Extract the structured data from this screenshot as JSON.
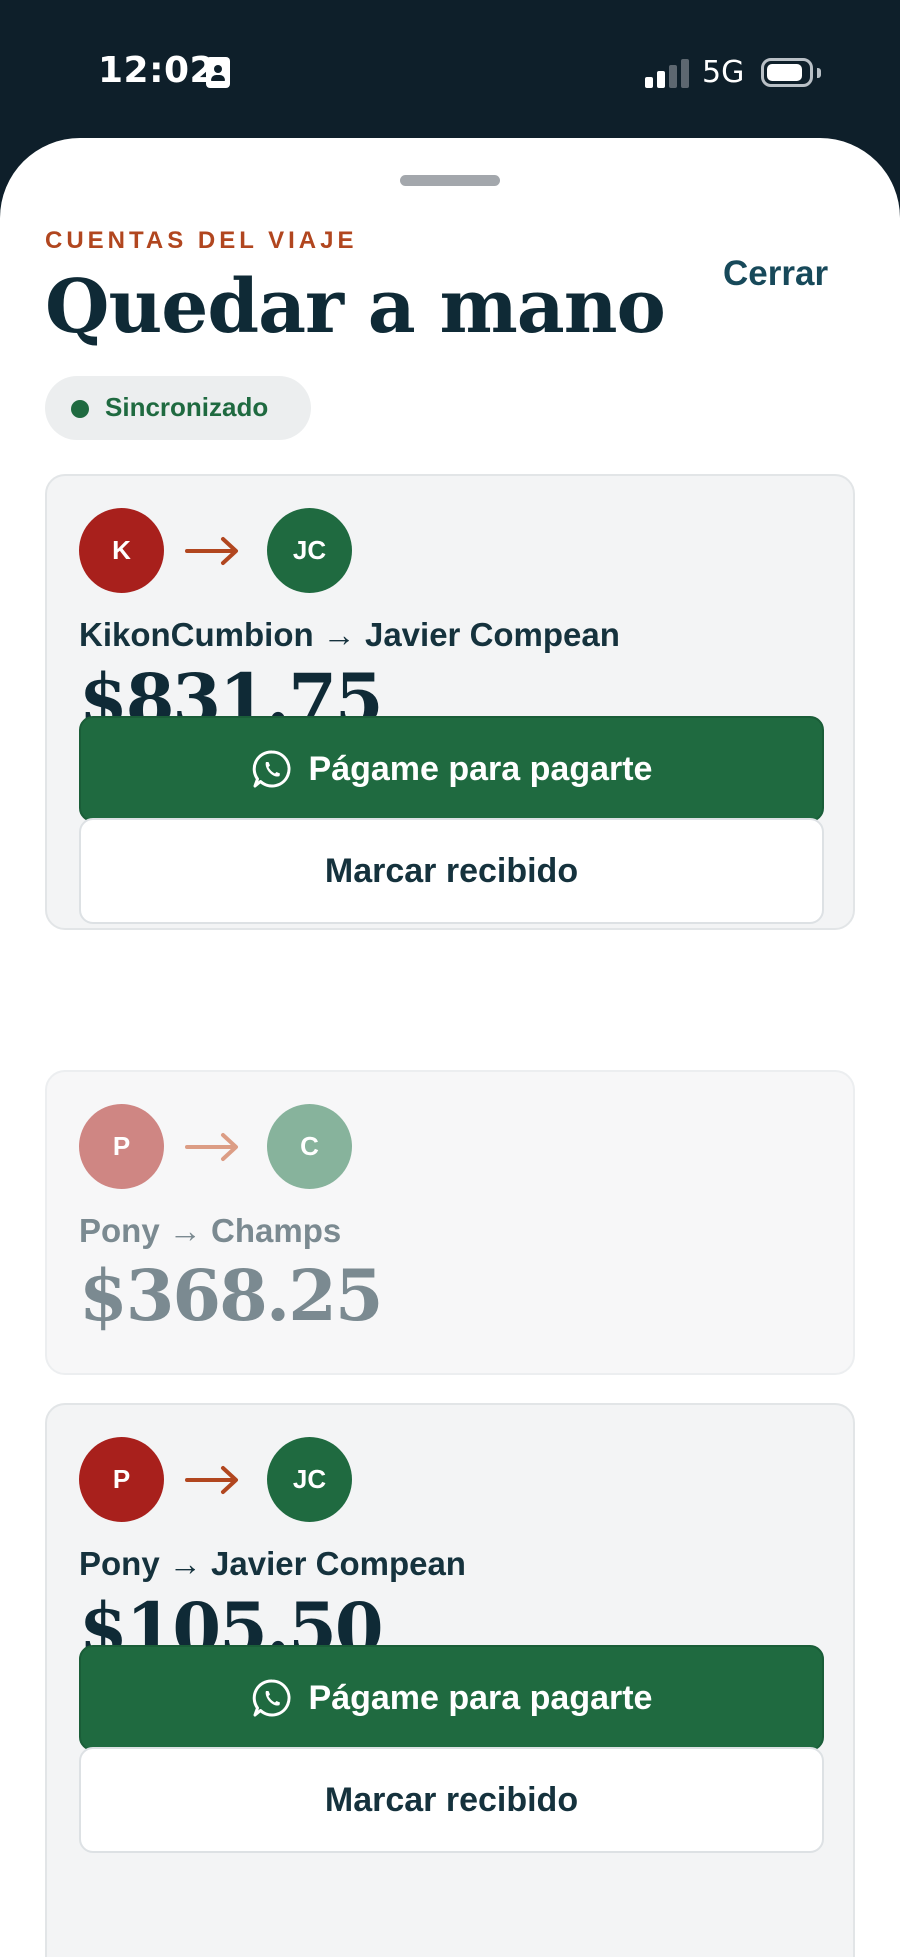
{
  "status_bar": {
    "time": "12:02",
    "network": "5G"
  },
  "header": {
    "eyebrow": "CUENTAS DEL VIAJE",
    "title": "Quedar a mano",
    "close_label": "Cerrar",
    "sync_status": "Sincronizado"
  },
  "colors": {
    "accent_green": "#1f6a40",
    "accent_orange": "#b1461f",
    "avatar_red": "#a8201c",
    "ink": "#0f2a36"
  },
  "settlements": [
    {
      "from_initials": "K",
      "to_initials": "JC",
      "names": "KikonCumbion → Javier Compean",
      "amount": "$831.75",
      "primary_action": "Págame para pagarte",
      "secondary_action": "Marcar recibido",
      "muted": false
    },
    {
      "from_initials": "P",
      "to_initials": "C",
      "names": "Pony → Champs",
      "amount": "$368.25",
      "muted": true
    },
    {
      "from_initials": "P",
      "to_initials": "JC",
      "names": "Pony → Javier Compean",
      "amount": "$105.50",
      "primary_action": "Págame para pagarte",
      "secondary_action": "Marcar recibido",
      "muted": false
    }
  ]
}
